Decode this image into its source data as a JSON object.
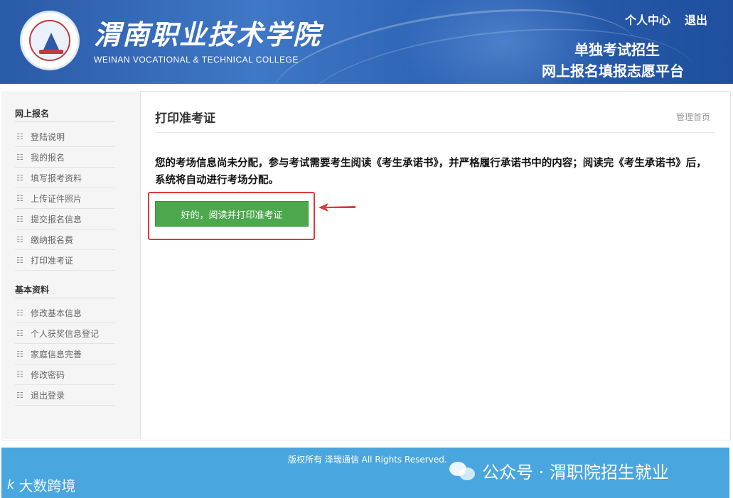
{
  "header": {
    "college_name_cn": "渭南职业技术学院",
    "college_name_en": "WEINAN VOCATIONAL & TECHNICAL COLLEGE",
    "links": [
      "个人中心",
      "退出"
    ],
    "platform_line1": "单独考试招生",
    "platform_line2": "网上报名填报志愿平台"
  },
  "sidebar": {
    "groups": [
      {
        "title": "网上报名",
        "items": [
          "登陆说明",
          "我的报名",
          "填写报考资料",
          "上传证件照片",
          "提交报名信息",
          "缴纳报名费",
          "打印准考证"
        ]
      },
      {
        "title": "基本资料",
        "items": [
          "修改基本信息",
          "个人获奖信息登记",
          "家庭信息完善",
          "修改密码",
          "退出登录"
        ]
      }
    ]
  },
  "main": {
    "title": "打印准考证",
    "home_link": "管理首页",
    "notice": "您的考场信息尚未分配，参与考试需要考生阅读《考生承诺书》，并严格履行承诺书中的内容；阅读完《考生承诺书》后，系统将自动进行考场分配。",
    "button_label": "好的，阅读并打印准考证"
  },
  "footer": {
    "copyright": "版权所有 泽瑞通信 All Rights Reserved.",
    "wechat_label": "公众号 · 渭职院招生就业",
    "watermark": "大数跨境",
    "watermark_logo": "k"
  },
  "colors": {
    "header_blue": "#2d63b4",
    "button_green": "#4ca84c",
    "highlight_red": "#e03a3a",
    "footer_blue": "#49a6de"
  }
}
